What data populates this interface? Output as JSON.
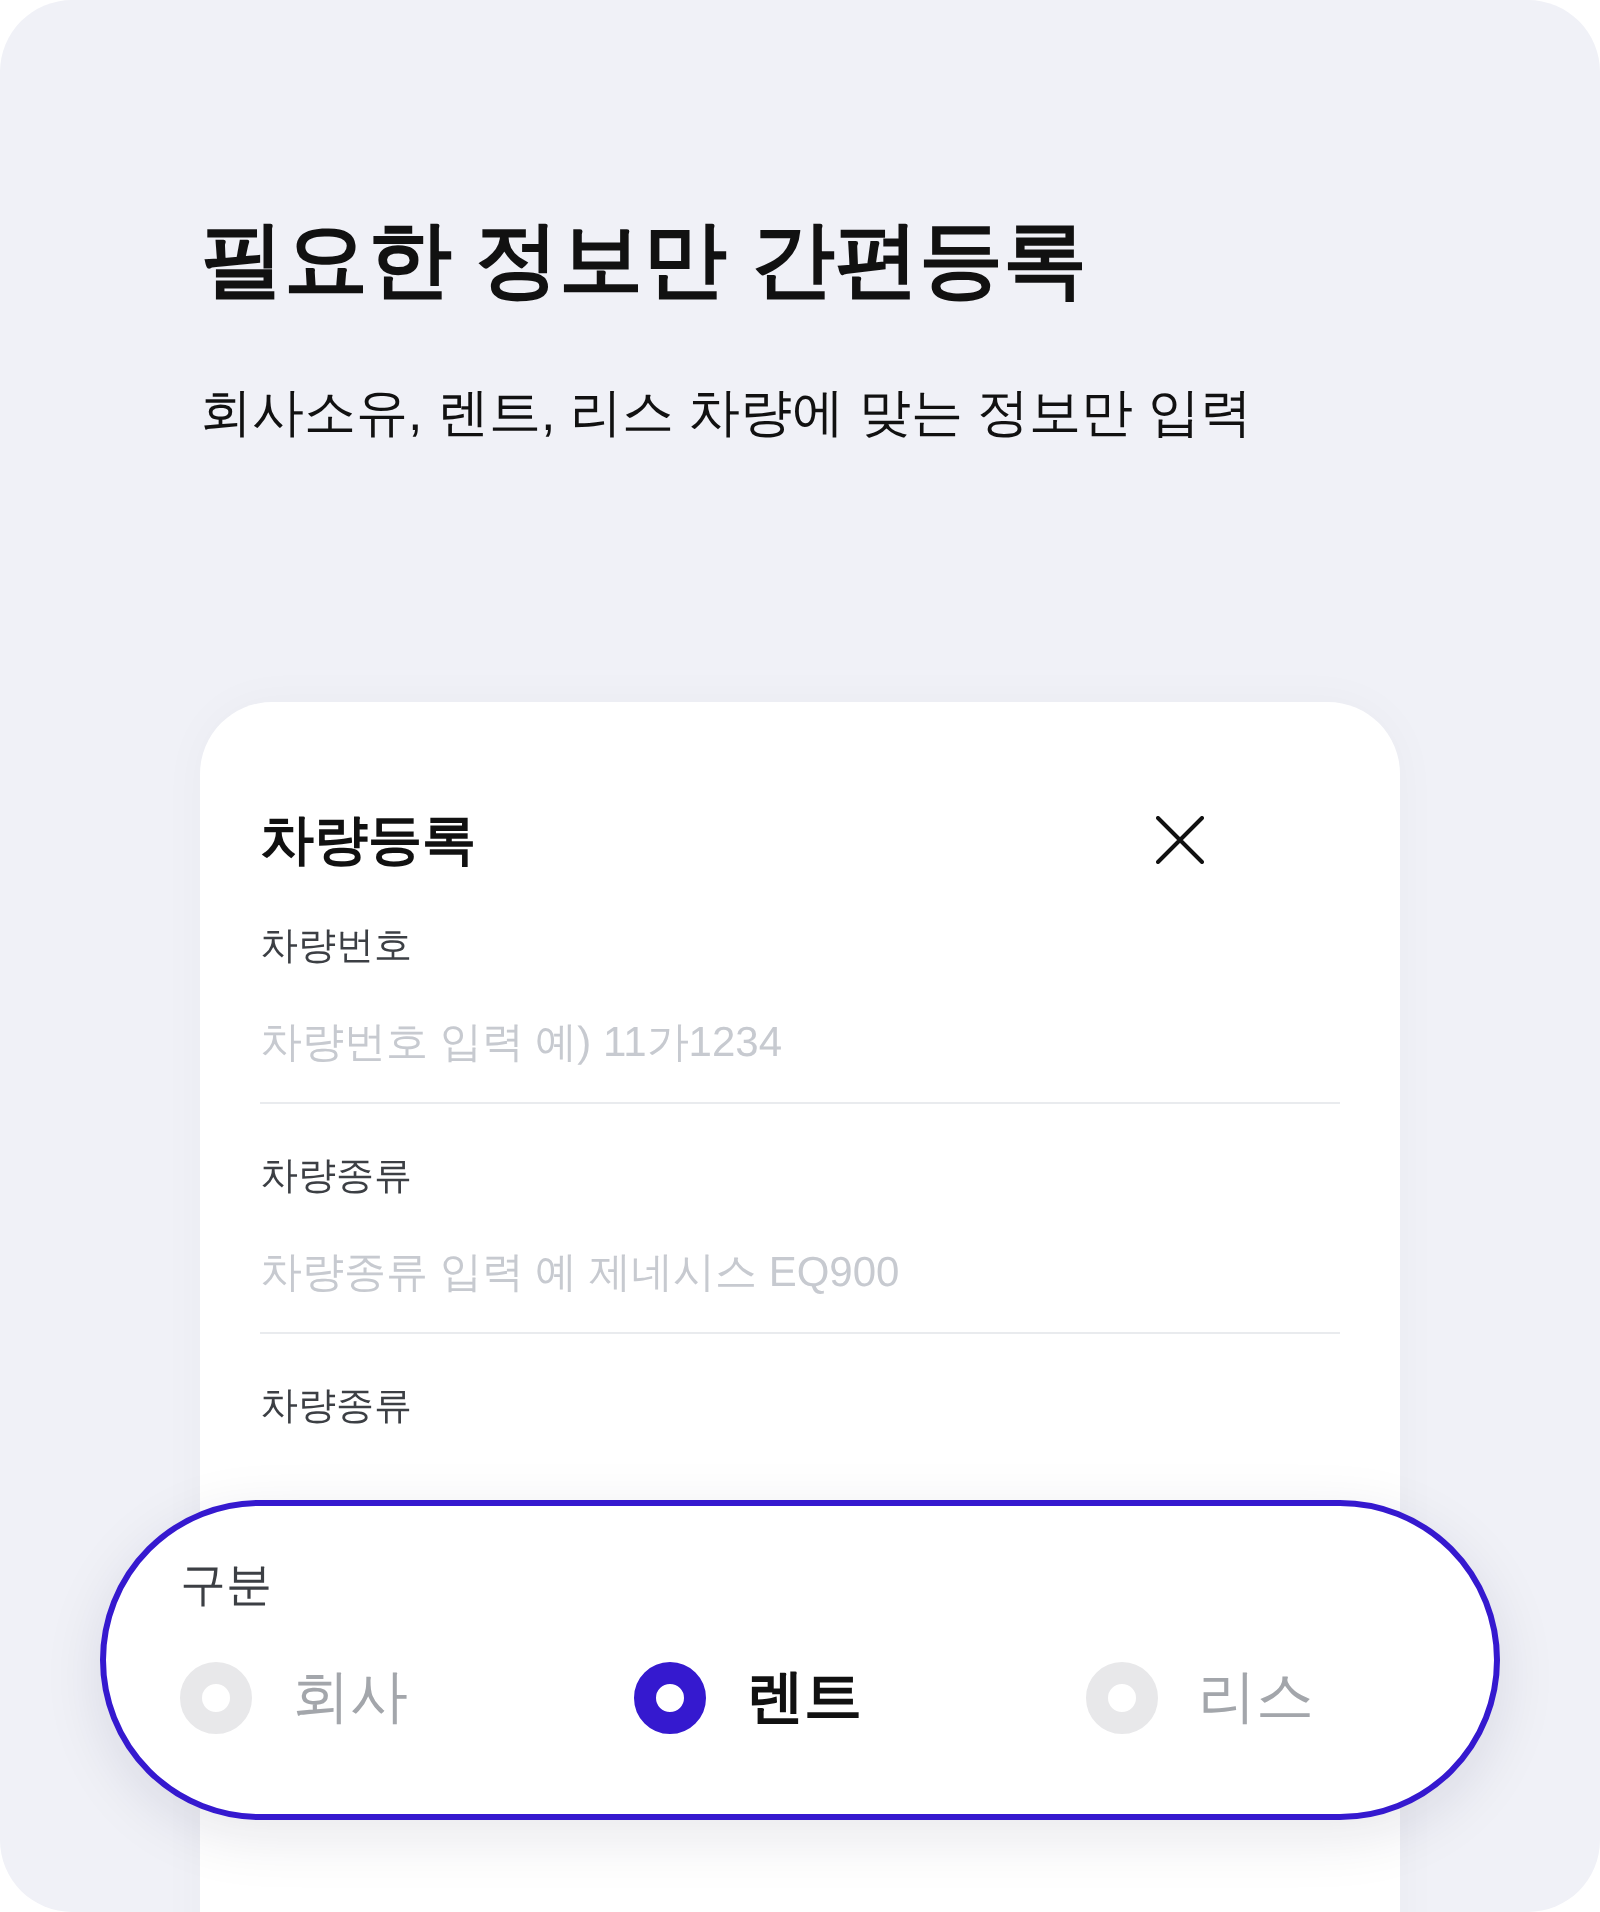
{
  "page": {
    "title": "필요한 정보만 간편등록",
    "subtitle": "회사소유, 렌트, 리스 차량에 맞는 정보만 입력"
  },
  "dialog": {
    "title": "차량등록",
    "fields": [
      {
        "label": "차량번호",
        "placeholder": "차량번호 입력 예) 11가1234"
      },
      {
        "label": "차량종류",
        "placeholder": "차량종류 입력 예 제네시스 EQ900"
      },
      {
        "label": "차량종류"
      }
    ]
  },
  "category": {
    "label": "구분",
    "options": [
      {
        "label": "회사",
        "selected": false
      },
      {
        "label": "렌트",
        "selected": true
      },
      {
        "label": "리스",
        "selected": false
      }
    ]
  }
}
